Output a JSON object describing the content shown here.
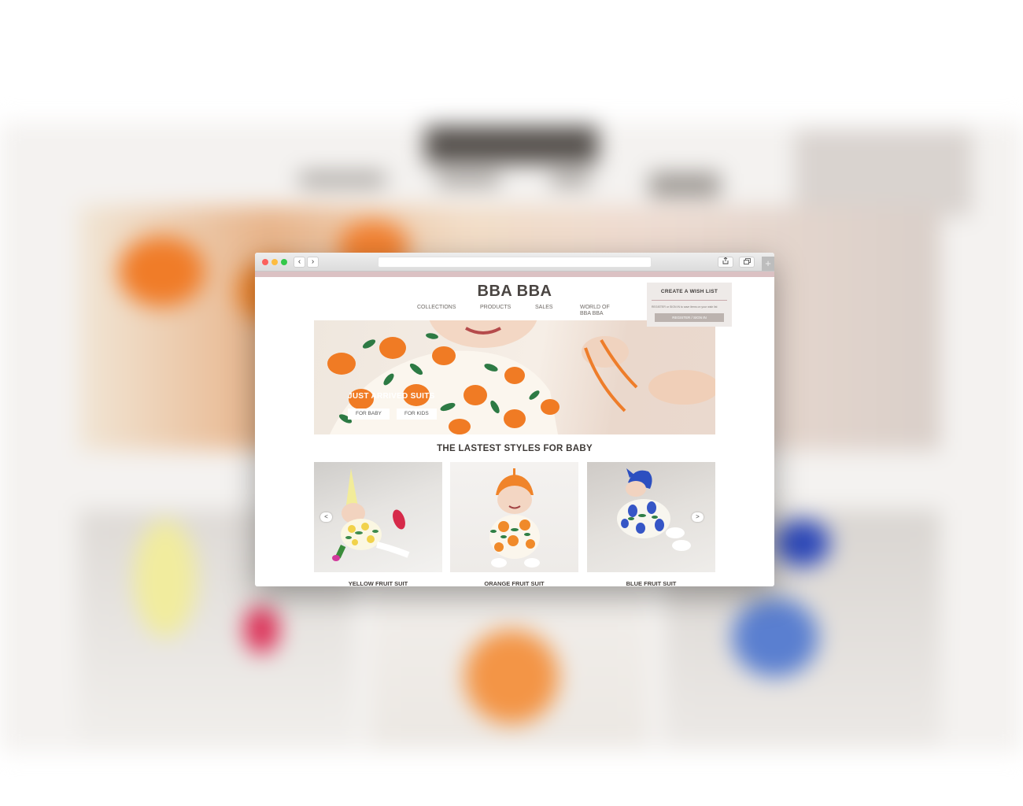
{
  "site": {
    "logo": "BBA BBA",
    "nav": [
      "COLLECTIONS",
      "PRODUCTS",
      "SALES",
      "WORLD OF BBA BBA"
    ],
    "nav_world_line1": "WORLD OF",
    "nav_world_line2": "BBA BBA"
  },
  "wishlist": {
    "title": "CREATE A WISH LIST",
    "text": "REGISTER or SIGN IN to save items on your wish list",
    "button": "REGISTER / SIGN IN"
  },
  "hero": {
    "headline": "JUST ARRIVED SUITS",
    "buttons": [
      "FOR BABY",
      "FOR KIDS"
    ]
  },
  "section": {
    "title": "THE LASTEST STYLES FOR BABY"
  },
  "products": [
    {
      "name": "YELLOW FRUIT SUIT",
      "accent": "#f2ec9a"
    },
    {
      "name": "ORANGE FRUIT SUIT",
      "accent": "#f08a2a"
    },
    {
      "name": "BLUE FRUIT SUIT",
      "accent": "#2c4fc0"
    }
  ],
  "carousel": {
    "prev": "<",
    "next": ">"
  },
  "browser": {
    "back": "‹",
    "forward": "›",
    "share_icon": "share-icon",
    "tabs_icon": "tabs-icon",
    "new_tab": "+"
  },
  "colors": {
    "pink_bar": "#dbc1c3",
    "text_dark": "#4a4542",
    "traffic_red": "#fc605c",
    "traffic_yellow": "#fdbc40",
    "traffic_green": "#34c84a"
  }
}
